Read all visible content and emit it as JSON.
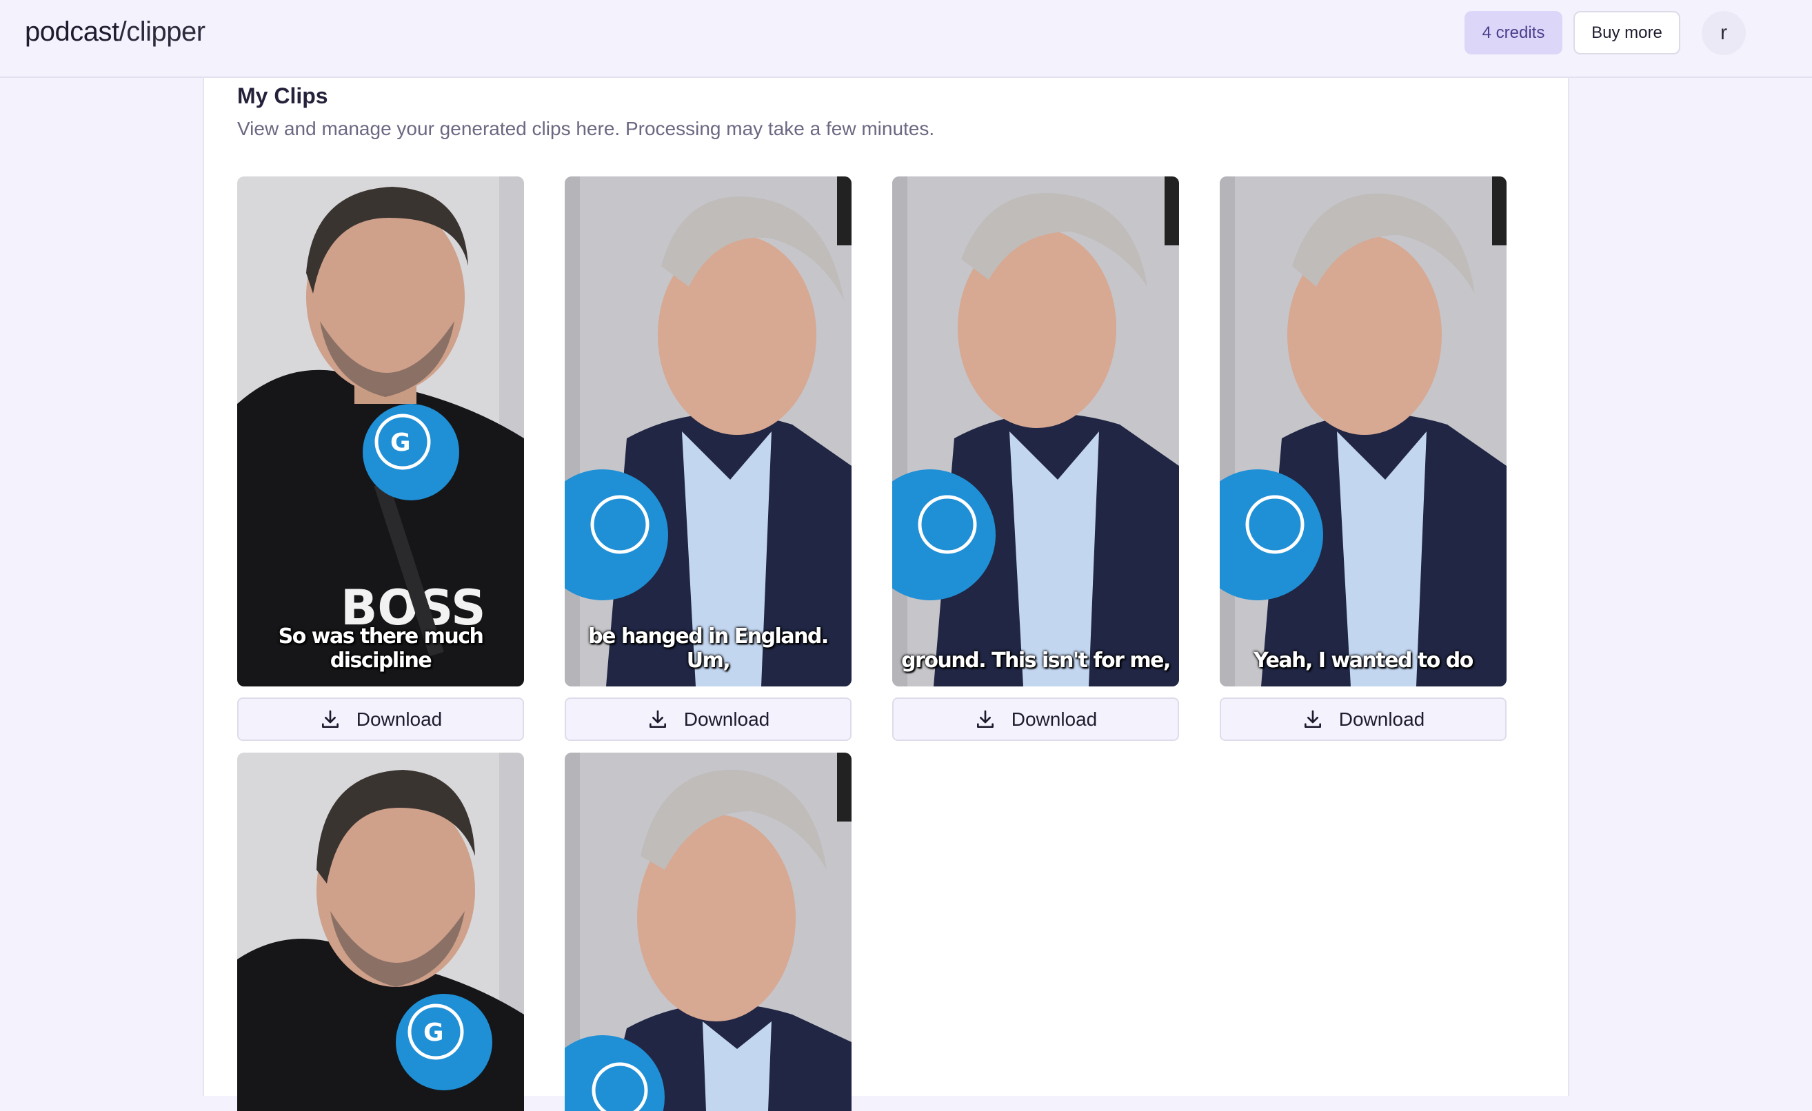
{
  "header": {
    "logo_part1": "podcast",
    "logo_part2": "/clipper",
    "credits": "4 credits",
    "buy_more": "Buy more",
    "avatar_initial": "r"
  },
  "main": {
    "title": "My Clips",
    "subtitle": "View and manage your generated clips here. Processing may take a few minutes.",
    "download_label": "Download",
    "clips": [
      {
        "caption": "So was there much discipline",
        "speaker": "younger-host"
      },
      {
        "caption": "be hanged in England. Um,",
        "speaker": "older-guest"
      },
      {
        "caption": "ground. This isn't for me,",
        "speaker": "older-guest"
      },
      {
        "caption": "Yeah, I wanted to do",
        "speaker": "older-guest"
      },
      {
        "caption": "",
        "speaker": "younger-host"
      },
      {
        "caption": "",
        "speaker": "older-guest"
      }
    ]
  },
  "colors": {
    "background": "#f4f3fd",
    "credits_badge": "#dcd6f8",
    "mic_blue": "#1f8fd6"
  }
}
